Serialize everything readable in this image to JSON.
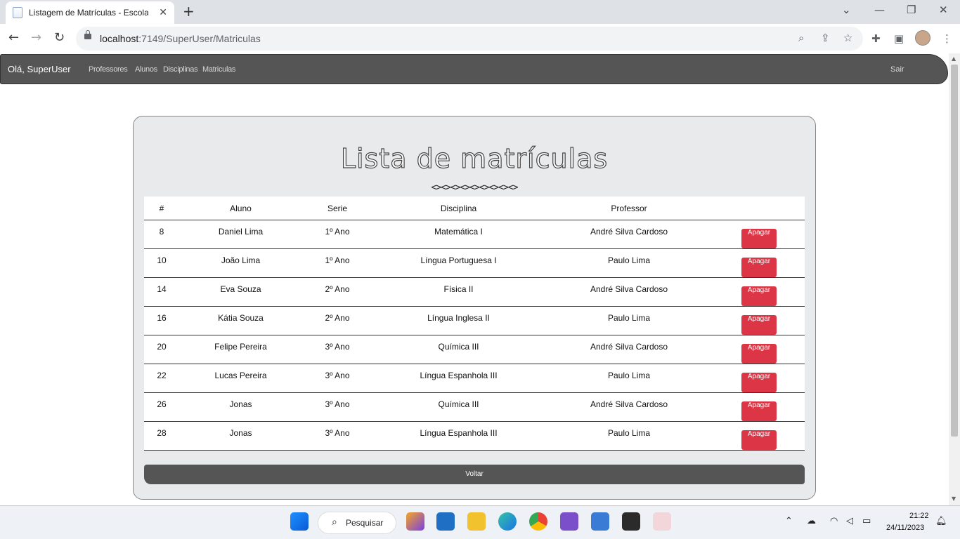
{
  "browser": {
    "tab_title": "Listagem de Matrículas - Escola",
    "tab_close": "✕",
    "new_tab": "+",
    "url_host": "localhost",
    "url_path": ":7149/SuperUser/Matriculas"
  },
  "navbar": {
    "greeting": "Olá, SuperUser",
    "links": [
      "Professores",
      "Alunos",
      "Disciplinas",
      "Matriculas"
    ],
    "logout": "Sair"
  },
  "main": {
    "title": "Lista de matrículas",
    "ornament": "<><><><><><><><><>",
    "columns": [
      "#",
      "Aluno",
      "Serie",
      "Disciplina",
      "Professor"
    ],
    "rows": [
      {
        "id": "8",
        "aluno": "Daniel Lima",
        "serie": "1º Ano",
        "disciplina": "Matemática I",
        "professor": "André Silva Cardoso",
        "action": "Apagar"
      },
      {
        "id": "10",
        "aluno": "João Lima",
        "serie": "1º Ano",
        "disciplina": "Língua Portuguesa I",
        "professor": "Paulo Lima",
        "action": "Apagar"
      },
      {
        "id": "14",
        "aluno": "Eva Souza",
        "serie": "2º Ano",
        "disciplina": "Física II",
        "professor": "André Silva Cardoso",
        "action": "Apagar"
      },
      {
        "id": "16",
        "aluno": "Kátia Souza",
        "serie": "2º Ano",
        "disciplina": "Língua Inglesa II",
        "professor": "Paulo Lima",
        "action": "Apagar"
      },
      {
        "id": "20",
        "aluno": "Felipe Pereira",
        "serie": "3º Ano",
        "disciplina": "Química III",
        "professor": "André Silva Cardoso",
        "action": "Apagar"
      },
      {
        "id": "22",
        "aluno": "Lucas Pereira",
        "serie": "3º Ano",
        "disciplina": "Língua Espanhola III",
        "professor": "Paulo Lima",
        "action": "Apagar"
      },
      {
        "id": "26",
        "aluno": "Jonas",
        "serie": "3º Ano",
        "disciplina": "Química III",
        "professor": "André Silva Cardoso",
        "action": "Apagar"
      },
      {
        "id": "28",
        "aluno": "Jonas",
        "serie": "3º Ano",
        "disciplina": "Língua Espanhola III",
        "professor": "Paulo Lima",
        "action": "Apagar"
      }
    ],
    "back_label": "Voltar"
  },
  "taskbar": {
    "search_label": "Pesquisar",
    "time": "21:22",
    "date": "24/11/2023"
  },
  "colors": {
    "navbar": "#555555",
    "delete_button": "#dc3545",
    "card_bg": "#e9eaec"
  }
}
